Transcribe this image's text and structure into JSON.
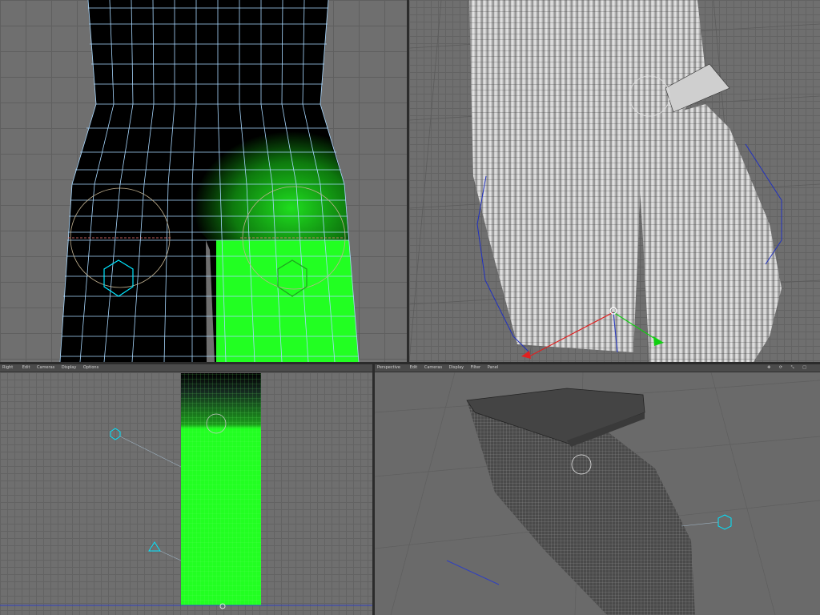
{
  "app": {
    "viewports": [
      {
        "id": "top-left",
        "title": "",
        "menu": []
      },
      {
        "id": "top-right",
        "title": "",
        "menu": []
      },
      {
        "id": "bottom-left",
        "title": "Right",
        "menu": [
          "Edit",
          "Cameras",
          "Display",
          "Options"
        ]
      },
      {
        "id": "bottom-right",
        "title": "Perspective",
        "menu": [
          "Edit",
          "Cameras",
          "Display",
          "Filter",
          "Panel"
        ]
      }
    ],
    "icons": [
      "move-icon",
      "rotate-icon",
      "scale-icon",
      "maximize-icon"
    ],
    "colors": {
      "background": "#6f6f6f",
      "mesh_dark": "#000000",
      "wireframe": "#a8d8ff",
      "paint_green": "#22ff22",
      "joint": "#00e5ff",
      "axis_x": "#e02020",
      "axis_y": "#10d010",
      "axis_z": "#3040c0"
    }
  }
}
